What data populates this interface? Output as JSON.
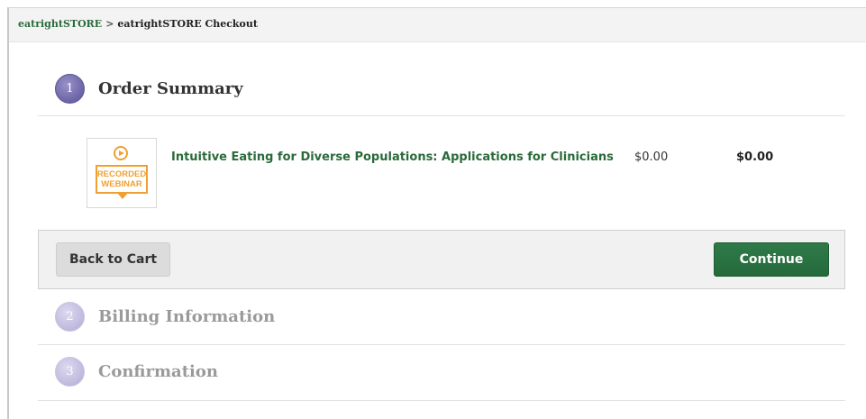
{
  "breadcrumb": {
    "root": "eatrightSTORE",
    "separator": ">",
    "current": "eatrightSTORE Checkout"
  },
  "steps": [
    {
      "number": "1",
      "title": "Order Summary",
      "state": "active"
    },
    {
      "number": "2",
      "title": "Billing Information",
      "state": "inactive"
    },
    {
      "number": "3",
      "title": "Confirmation",
      "state": "inactive"
    }
  ],
  "order": {
    "items": [
      {
        "thumbnail": {
          "line1": "RECORDED",
          "line2": "WEBINAR",
          "icon": "play-icon"
        },
        "name": "Intuitive Eating for Diverse Populations: Applications for Clinicians",
        "unit_price": "$0.00",
        "total": "$0.00"
      }
    ]
  },
  "actions": {
    "back_label": "Back to Cart",
    "continue_label": "Continue"
  },
  "colors": {
    "brand_green": "#2a6a3a",
    "step_purple": "#6b64a6",
    "webinar_orange": "#f0a032"
  }
}
